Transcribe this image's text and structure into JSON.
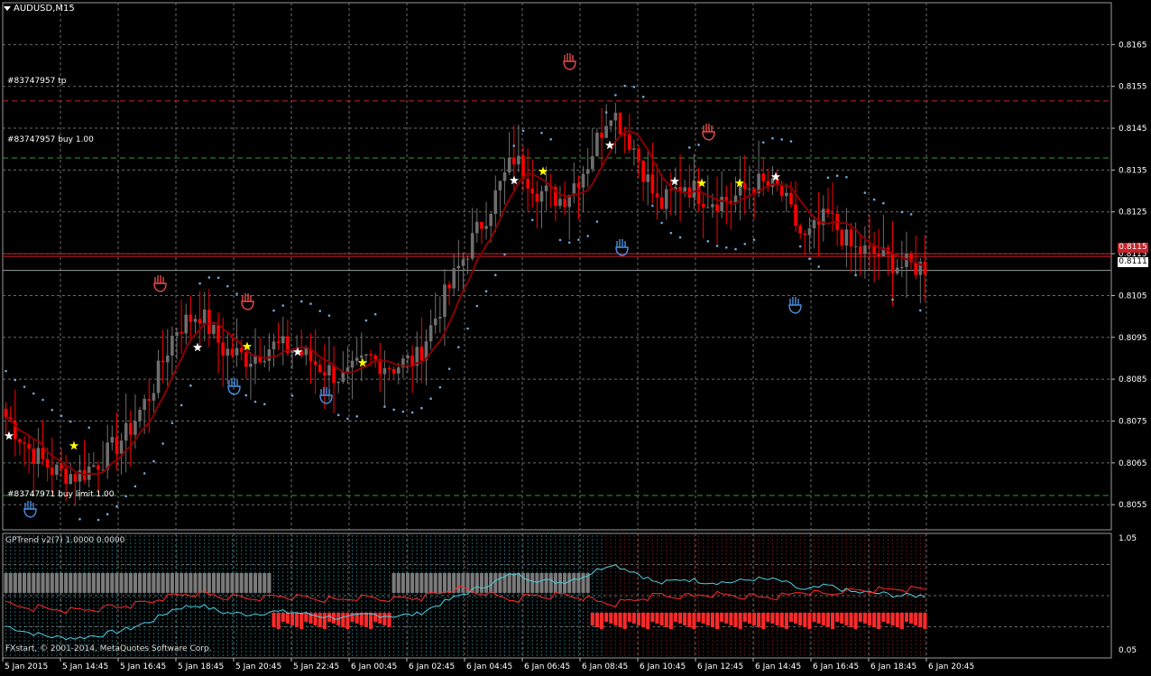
{
  "window": {
    "title": "AUDUSD,M15"
  },
  "orders": [
    {
      "label": "#83747957 tp",
      "price": 0.81515,
      "color": "#c8232a"
    },
    {
      "label": "#83747957 buy 1.00",
      "price": 0.81379,
      "color": "#2e9b36"
    },
    {
      "label": "#83747971 buy limit 1.00",
      "price": 0.80572,
      "color": "#2e9b36"
    }
  ],
  "price_labels": {
    "ask": "0.8115",
    "bid": "0.8111"
  },
  "indicator": {
    "title": "GPTrend v2(7) 1.0000 0.0000",
    "scale_top": "1.05",
    "scale_bottom": "0.05"
  },
  "footer": {
    "copyright": "FXstart, © 2001-2014, MetaQuotes Software Corp."
  },
  "colors": {
    "background": "#000000",
    "grid": "#6b6b6b",
    "bull_candle": "#6e6e6e",
    "bear_candle": "#ff0000",
    "moving_average": "#8b0000",
    "sar_dots": "#6fa8dc",
    "star": "#ffff00",
    "hand_up": "#e84a4a",
    "hand_down": "#4a90e2",
    "ind_cyan": "#4dd0e1",
    "ind_red": "#ff2a2a"
  },
  "chart_data": [
    {
      "type": "candlestick",
      "symbol": "AUDUSD",
      "timeframe": "M15",
      "ylim": [
        0.8049,
        0.8175
      ],
      "y_ticks": [
        "0.8165",
        "0.8155",
        "0.8145",
        "0.8135",
        "0.8125",
        "0.8115",
        "0.8105",
        "0.8095",
        "0.8085",
        "0.8075",
        "0.8065",
        "0.8055"
      ],
      "x_ticks": [
        "5 Jan 2015",
        "5 Jan 14:45",
        "5 Jan 16:45",
        "5 Jan 18:45",
        "5 Jan 20:45",
        "5 Jan 22:45",
        "6 Jan 00:45",
        "6 Jan 02:45",
        "6 Jan 04:45",
        "6 Jan 06:45",
        "6 Jan 08:45",
        "6 Jan 10:45",
        "6 Jan 12:45",
        "6 Jan 14:45",
        "6 Jan 16:45",
        "6 Jan 18:45",
        "6 Jan 20:45"
      ],
      "anchor_close": [
        0.8076,
        0.8068,
        0.8063,
        0.8062,
        0.8066,
        0.8072,
        0.8082,
        0.8097,
        0.8101,
        0.8092,
        0.809,
        0.8093,
        0.8092,
        0.8088,
        0.8085,
        0.809,
        0.8088,
        0.809,
        0.8103,
        0.8115,
        0.8126,
        0.8138,
        0.813,
        0.8128,
        0.8136,
        0.815,
        0.814,
        0.8126,
        0.8132,
        0.8128,
        0.8128,
        0.8132,
        0.813,
        0.8118,
        0.8124,
        0.8116,
        0.8115,
        0.8112,
        0.8112
      ],
      "grid": true
    },
    {
      "type": "histogram",
      "title": "GPTrend v2(7) 1.0000 0.0000",
      "ylim": [
        0.05,
        1.05
      ],
      "grid": true
    }
  ]
}
